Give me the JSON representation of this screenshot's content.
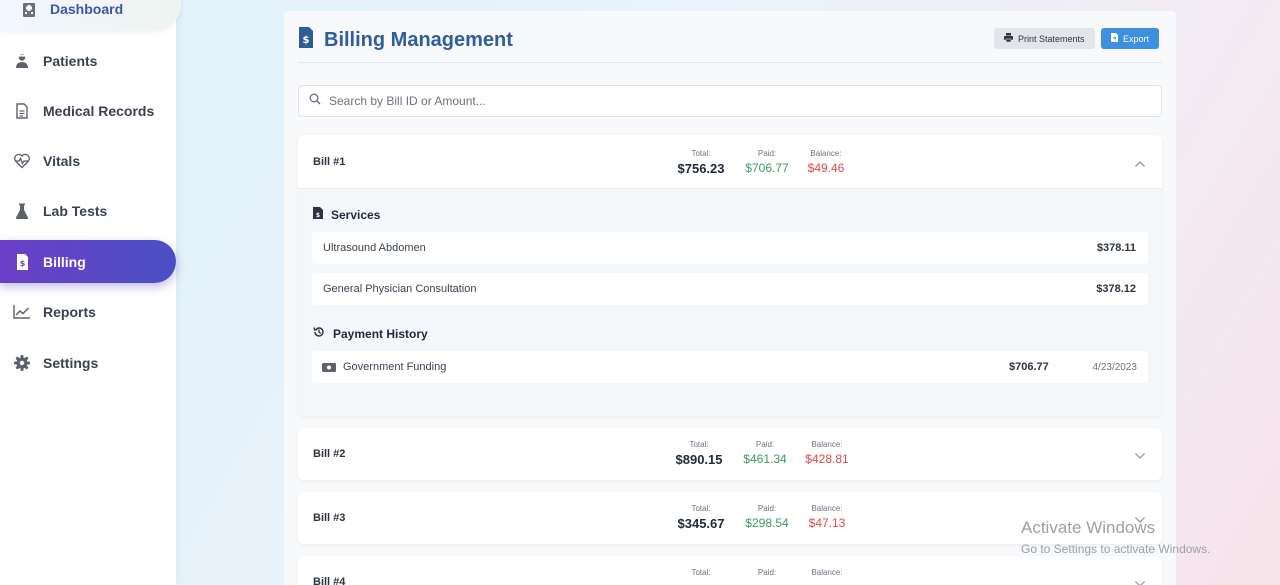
{
  "sidebar": {
    "items": [
      {
        "label": "Dashboard",
        "icon": "hospital-icon"
      },
      {
        "label": "Patients",
        "icon": "user-doctor-icon"
      },
      {
        "label": "Medical Records",
        "icon": "file-lines-icon"
      },
      {
        "label": "Vitals",
        "icon": "heart-pulse-icon"
      },
      {
        "label": "Lab Tests",
        "icon": "flask-icon"
      },
      {
        "label": "Billing",
        "icon": "file-invoice-dollar-icon"
      },
      {
        "label": "Reports",
        "icon": "chart-line-icon"
      },
      {
        "label": "Settings",
        "icon": "gear-icon"
      }
    ],
    "active": "Billing"
  },
  "main": {
    "title": "Billing Management",
    "print_label": "Print Statements",
    "export_label": "Export",
    "search_placeholder": "Search by Bill ID or Amount..."
  },
  "labels": {
    "total": "Total:",
    "paid": "Paid:",
    "balance": "Balance:",
    "services": "Services",
    "payment_history": "Payment History"
  },
  "bills": [
    {
      "name": "Bill #1",
      "total": "$756.23",
      "paid": "$706.77",
      "balance": "$49.46",
      "expanded": true
    },
    {
      "name": "Bill #2",
      "total": "$890.15",
      "paid": "$461.34",
      "balance": "$428.81",
      "expanded": false
    },
    {
      "name": "Bill #3",
      "total": "$345.67",
      "paid": "$298.54",
      "balance": "$47.13",
      "expanded": false
    },
    {
      "name": "Bill #4",
      "total": "",
      "paid": "",
      "balance": "",
      "expanded": false
    }
  ],
  "bill1_services": [
    {
      "name": "Ultrasound Abdomen",
      "price": "$378.11"
    },
    {
      "name": "General Physician Consultation",
      "price": "$378.12"
    }
  ],
  "bill1_payments": [
    {
      "method": "Government Funding",
      "amount": "$706.77",
      "date": "4/23/2023"
    }
  ],
  "watermark": {
    "line1": "Activate Windows",
    "line2": "Go to Settings to activate Windows."
  },
  "colors": {
    "accent": "#2f5d99",
    "active_nav": "#5a46c8",
    "paid": "#3a9b5c",
    "balance": "#e0484a",
    "export_button": "#3d8fe0"
  }
}
